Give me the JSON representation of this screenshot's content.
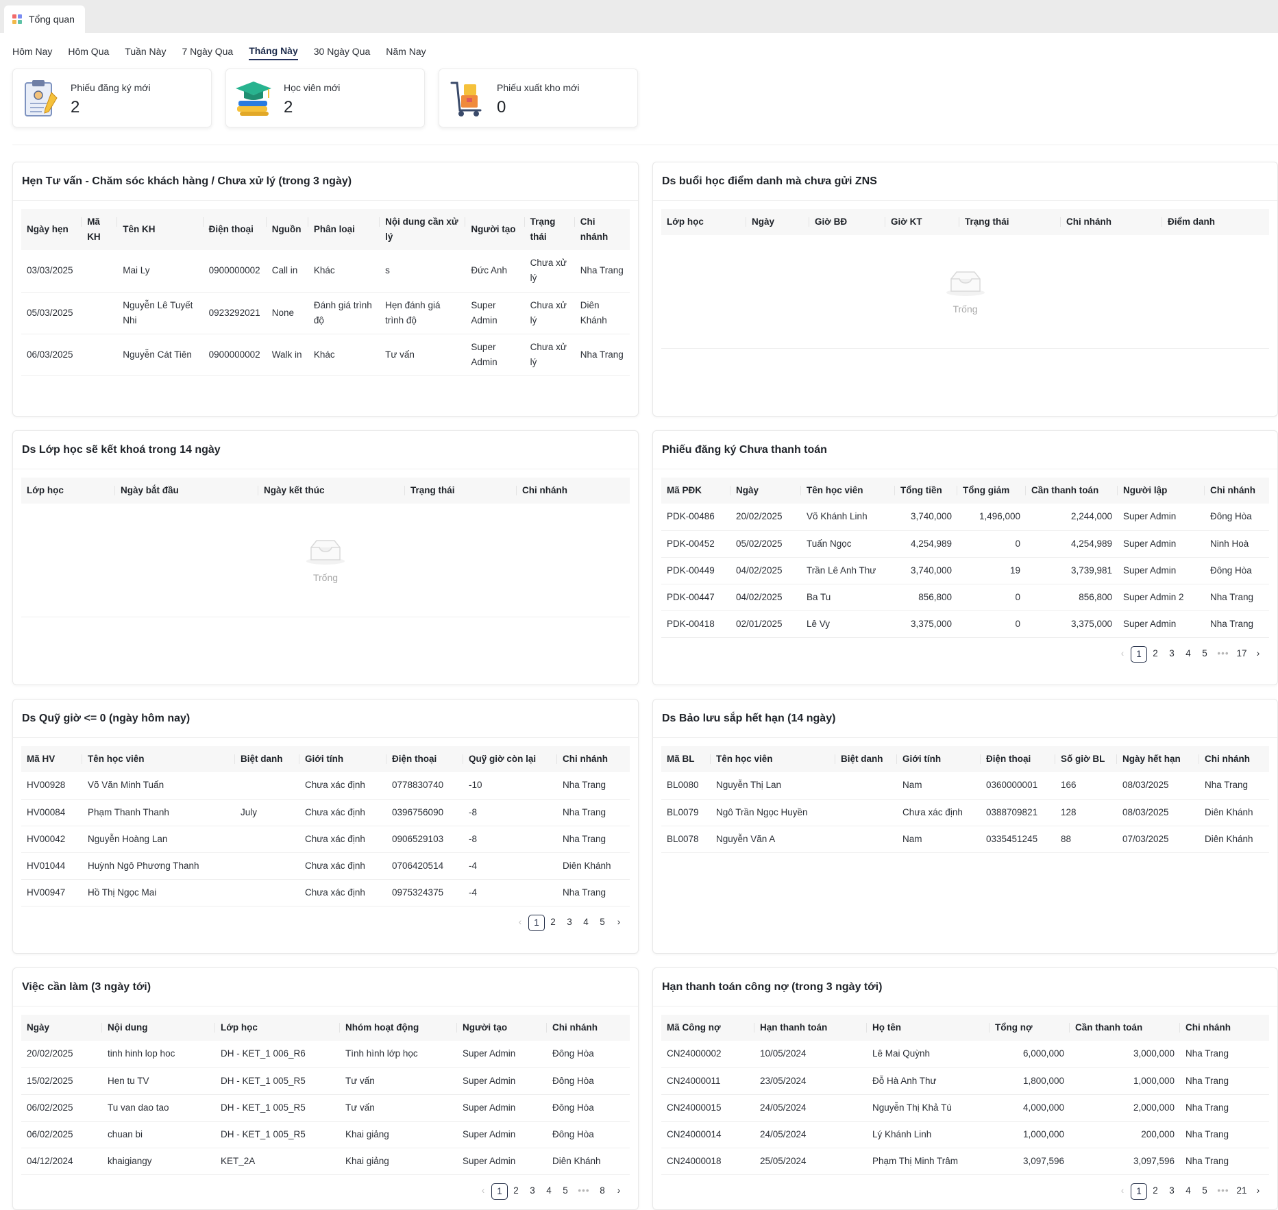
{
  "tab": {
    "label": "Tổng quan"
  },
  "filters": [
    "Hôm Nay",
    "Hôm Qua",
    "Tuần Này",
    "7 Ngày Qua",
    "Tháng Này",
    "30 Ngày Qua",
    "Năm Nay"
  ],
  "stats": [
    {
      "label": "Phiếu đăng ký mới",
      "value": "2"
    },
    {
      "label": "Học viên mới",
      "value": "2"
    },
    {
      "label": "Phiếu xuất kho mới",
      "value": "0"
    }
  ],
  "empty_text": "Trống",
  "consult": {
    "title": "Hẹn Tư vấn - Chăm sóc khách hàng / Chưa xử lý (trong 3 ngày)",
    "columns": [
      "Ngày hẹn",
      "Mã KH",
      "Tên KH",
      "Điện thoại",
      "Nguồn",
      "Phân loại",
      "Nội dung cần xử lý",
      "Người tạo",
      "Trạng thái",
      "Chi nhánh"
    ],
    "rows": [
      [
        "03/03/2025",
        "",
        "Mai Ly",
        "0900000002",
        "Call in",
        "Khác",
        "s",
        "Đức Anh",
        "Chưa xử lý",
        "Nha Trang"
      ],
      [
        "05/03/2025",
        "",
        "Nguyễn Lê Tuyết Nhi",
        "0923292021",
        "None",
        "Đánh giá trình độ",
        "Hẹn đánh giá trình độ",
        "Super Admin",
        "Chưa xử lý",
        "Diên Khánh"
      ],
      [
        "06/03/2025",
        "",
        "Nguyễn Cát Tiên",
        "0900000002",
        "Walk in",
        "Khác",
        "Tư vấn",
        "Super Admin",
        "Chưa xử lý",
        "Nha Trang"
      ]
    ]
  },
  "zns": {
    "title": "Ds buổi học điểm danh mà chưa gửi ZNS",
    "columns": [
      "Lớp học",
      "Ngày",
      "Giờ BĐ",
      "Giờ KT",
      "Trạng thái",
      "Chi nhánh",
      "Điểm danh"
    ]
  },
  "closing": {
    "title": "Ds Lớp học sẽ kết khoá trong 14 ngày",
    "columns": [
      "Lớp học",
      "Ngày bắt đầu",
      "Ngày kết thúc",
      "Trạng thái",
      "Chi nhánh"
    ]
  },
  "unpaid": {
    "title": "Phiếu đăng ký Chưa thanh toán",
    "columns": [
      "Mã PĐK",
      "Ngày",
      "Tên học viên",
      "Tổng tiền",
      "Tổng giảm",
      "Cần thanh toán",
      "Người lập",
      "Chi nhánh"
    ],
    "rows": [
      [
        "PDK-00486",
        "20/02/2025",
        "Võ Khánh Linh",
        "3,740,000",
        "1,496,000",
        "2,244,000",
        "Super Admin",
        "Đông Hòa"
      ],
      [
        "PDK-00452",
        "05/02/2025",
        "Tuấn Ngọc",
        "4,254,989",
        "0",
        "4,254,989",
        "Super Admin",
        "Ninh Hoà"
      ],
      [
        "PDK-00449",
        "04/02/2025",
        "Trần Lê Anh Thư",
        "3,740,000",
        "19",
        "3,739,981",
        "Super Admin",
        "Đông Hòa"
      ],
      [
        "PDK-00447",
        "04/02/2025",
        "Ba Tu",
        "856,800",
        "0",
        "856,800",
        "Super Admin 2",
        "Nha Trang"
      ],
      [
        "PDK-00418",
        "02/01/2025",
        "Lê Vy",
        "3,375,000",
        "0",
        "3,375,000",
        "Super Admin",
        "Nha Trang"
      ]
    ],
    "pager": [
      "1",
      "2",
      "3",
      "4",
      "5",
      "•••",
      "17"
    ]
  },
  "quota": {
    "title": "Ds Quỹ giờ <= 0 (ngày hôm nay)",
    "columns": [
      "Mã HV",
      "Tên học viên",
      "Biệt danh",
      "Giới tính",
      "Điện thoại",
      "Quỹ giờ còn lại",
      "Chi nhánh"
    ],
    "rows": [
      [
        "HV00928",
        "Võ Văn Minh Tuấn",
        "",
        "Chưa xác định",
        "0778830740",
        "-10",
        "Nha Trang"
      ],
      [
        "HV00084",
        "Phạm Thanh Thanh",
        "July",
        "Chưa xác định",
        "0396756090",
        "-8",
        "Nha Trang"
      ],
      [
        "HV00042",
        "Nguyễn Hoàng Lan",
        "",
        "Chưa xác định",
        "0906529103",
        "-8",
        "Nha Trang"
      ],
      [
        "HV01044",
        "Huỳnh Ngô Phương Thanh",
        "",
        "Chưa xác định",
        "0706420514",
        "-4",
        "Diên Khánh"
      ],
      [
        "HV00947",
        "Hồ Thị Ngọc Mai",
        "",
        "Chưa xác định",
        "0975324375",
        "-4",
        "Nha Trang"
      ]
    ],
    "pager": [
      "1",
      "2",
      "3",
      "4",
      "5"
    ]
  },
  "reserve": {
    "title": "Ds Bảo lưu sắp hết hạn (14 ngày)",
    "columns": [
      "Mã BL",
      "Tên học viên",
      "Biệt danh",
      "Giới tính",
      "Điện thoại",
      "Số giờ BL",
      "Ngày hết hạn",
      "Chi nhánh"
    ],
    "rows": [
      [
        "BL0080",
        "Nguyễn Thị Lan",
        "",
        "Nam",
        "0360000001",
        "166",
        "08/03/2025",
        "Nha Trang"
      ],
      [
        "BL0079",
        "Ngô Trần Ngọc Huyền",
        "",
        "Chưa xác định",
        "0388709821",
        "128",
        "08/03/2025",
        "Diên Khánh"
      ],
      [
        "BL0078",
        "Nguyễn Văn A",
        "",
        "Nam",
        "0335451245",
        "88",
        "07/03/2025",
        "Diên Khánh"
      ]
    ]
  },
  "todo": {
    "title": "Việc cần làm (3 ngày tới)",
    "columns": [
      "Ngày",
      "Nội dung",
      "Lớp học",
      "Nhóm hoạt động",
      "Người tạo",
      "Chi nhánh"
    ],
    "rows": [
      [
        "20/02/2025",
        "tinh hinh lop hoc",
        "DH - KET_1 006_R6",
        "Tình hình lớp học",
        "Super Admin",
        "Đông Hòa"
      ],
      [
        "15/02/2025",
        "Hen tu TV",
        "DH - KET_1 005_R5",
        "Tư vấn",
        "Super Admin",
        "Đông Hòa"
      ],
      [
        "06/02/2025",
        "Tu van dao tao",
        "DH - KET_1 005_R5",
        "Tư vấn",
        "Super Admin",
        "Đông Hòa"
      ],
      [
        "06/02/2025",
        "chuan bi",
        "DH - KET_1 005_R5",
        "Khai giảng",
        "Super Admin",
        "Đông Hòa"
      ],
      [
        "04/12/2024",
        "khaigiangy",
        "KET_2A",
        "Khai giảng",
        "Super Admin",
        "Diên Khánh"
      ]
    ],
    "pager": [
      "1",
      "2",
      "3",
      "4",
      "5",
      "•••",
      "8"
    ]
  },
  "debt": {
    "title": "Hạn thanh toán công nợ (trong 3 ngày tới)",
    "columns": [
      "Mã Công nợ",
      "Hạn thanh toán",
      "Họ tên",
      "Tổng nợ",
      "Cần thanh toán",
      "Chi nhánh"
    ],
    "rows": [
      [
        "CN24000002",
        "10/05/2024",
        "Lê Mai Quỳnh",
        "6,000,000",
        "3,000,000",
        "Nha Trang"
      ],
      [
        "CN24000011",
        "23/05/2024",
        "Đỗ Hà Anh Thư",
        "1,800,000",
        "1,000,000",
        "Nha Trang"
      ],
      [
        "CN24000015",
        "24/05/2024",
        "Nguyễn Thị Khả Tú",
        "4,000,000",
        "2,000,000",
        "Nha Trang"
      ],
      [
        "CN24000014",
        "24/05/2024",
        "Lý Khánh Linh",
        "1,000,000",
        "200,000",
        "Nha Trang"
      ],
      [
        "CN24000018",
        "25/05/2024",
        "Phạm Thị Minh Trâm",
        "3,097,596",
        "3,097,596",
        "Nha Trang"
      ]
    ],
    "pager": [
      "1",
      "2",
      "3",
      "4",
      "5",
      "•••",
      "21"
    ]
  },
  "colors": {
    "accent": "#23305c",
    "header_bg": "#f7f7f7",
    "topbar": "#ebebeb"
  }
}
